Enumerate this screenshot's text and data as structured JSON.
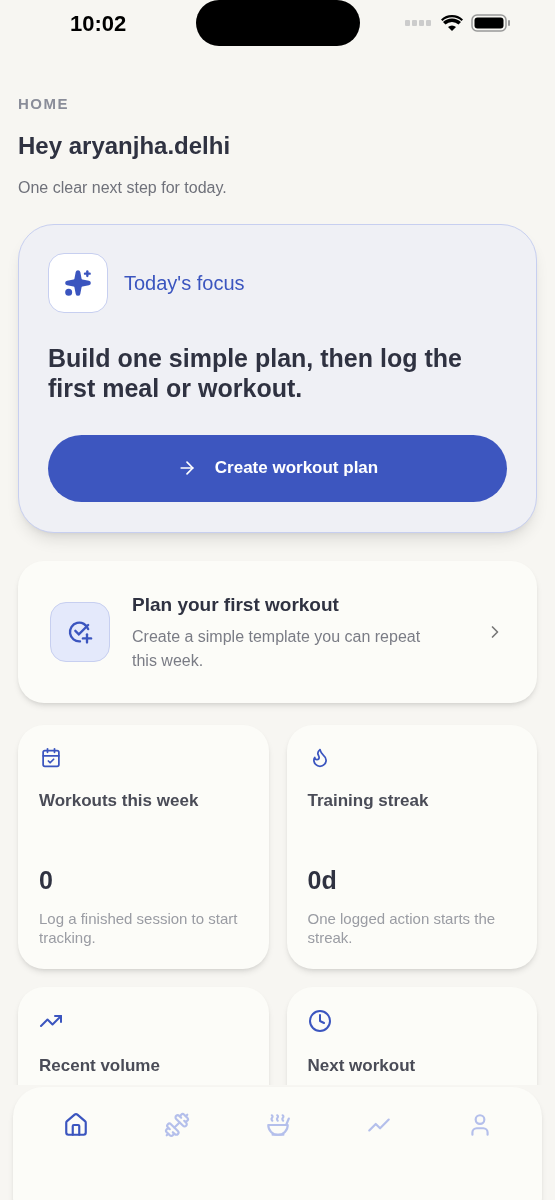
{
  "status_bar": {
    "time": "10:02"
  },
  "header": {
    "eyebrow": "HOME",
    "title": "Hey aryanjha.delhi",
    "subtitle": "One clear next step for today."
  },
  "focus": {
    "label": "Today's focus",
    "headline": "Build one simple plan, then log the first meal or workout.",
    "button": "Create workout plan"
  },
  "next_step": {
    "title": "Plan your first workout",
    "description": "Create a simple template you can repeat this week."
  },
  "stats": [
    {
      "title": "Workouts this week",
      "value": "0",
      "note": "Log a finished session to start tracking."
    },
    {
      "title": "Training streak",
      "value": "0d",
      "note": "One logged action starts the streak."
    },
    {
      "title": "Recent volume"
    },
    {
      "title": "Next workout"
    }
  ],
  "tab_bar": [
    {
      "selected": true
    },
    {
      "selected": false
    },
    {
      "selected": false
    },
    {
      "selected": false
    },
    {
      "selected": false
    }
  ]
}
